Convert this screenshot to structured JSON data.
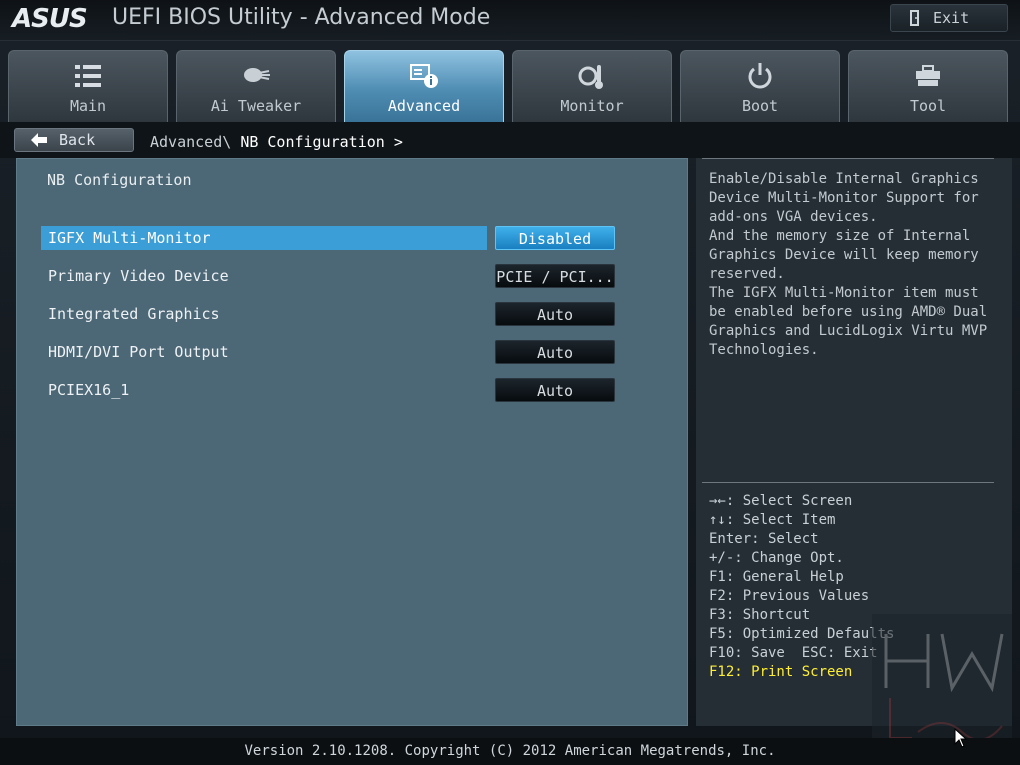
{
  "header": {
    "logo": "ASUS",
    "title": "UEFI BIOS Utility - Advanced Mode",
    "exit_label": "Exit"
  },
  "tabs": [
    {
      "label": "Main",
      "icon": "list-icon"
    },
    {
      "label": "Ai Tweaker",
      "icon": "tweaker-icon"
    },
    {
      "label": "Advanced",
      "icon": "advanced-icon",
      "active": true
    },
    {
      "label": "Monitor",
      "icon": "monitor-icon"
    },
    {
      "label": "Boot",
      "icon": "power-icon"
    },
    {
      "label": "Tool",
      "icon": "tool-icon"
    }
  ],
  "breadcrumb": {
    "back_label": "Back",
    "path": "Advanced\\",
    "current": "NB Configuration >"
  },
  "main": {
    "section_title": "NB Configuration",
    "settings": [
      {
        "name": "IGFX Multi-Monitor",
        "value": "Disabled",
        "selected": true
      },
      {
        "name": "Primary Video Device",
        "value": "PCIE / PCI..."
      },
      {
        "name": "Integrated Graphics",
        "value": "Auto"
      },
      {
        "name": "HDMI/DVI Port Output",
        "value": "Auto"
      },
      {
        "name": "PCIEX16_1",
        "value": "Auto"
      }
    ]
  },
  "help_text": "Enable/Disable Internal Graphics Device Multi-Monitor Support for add-ons VGA devices.\nAnd the memory size of Internal Graphics Device will keep memory reserved.\nThe IGFX Multi-Monitor item must be enabled before using AMD® Dual Graphics and LucidLogix Virtu MVP Technologies.",
  "key_help": [
    "→←: Select Screen",
    "↑↓: Select Item",
    "Enter: Select",
    "+/-: Change Opt.",
    "F1: General Help",
    "F2: Previous Values",
    "F3: Shortcut",
    "F5: Optimized Defaults",
    "F10: Save  ESC: Exit",
    "F12: Print Screen"
  ],
  "footer": "Version 2.10.1208. Copyright (C) 2012 American Megatrends, Inc.",
  "colors": {
    "accent": "#3b9ed6",
    "highlight_key": "#ffee33",
    "panel": "#4c6776"
  }
}
